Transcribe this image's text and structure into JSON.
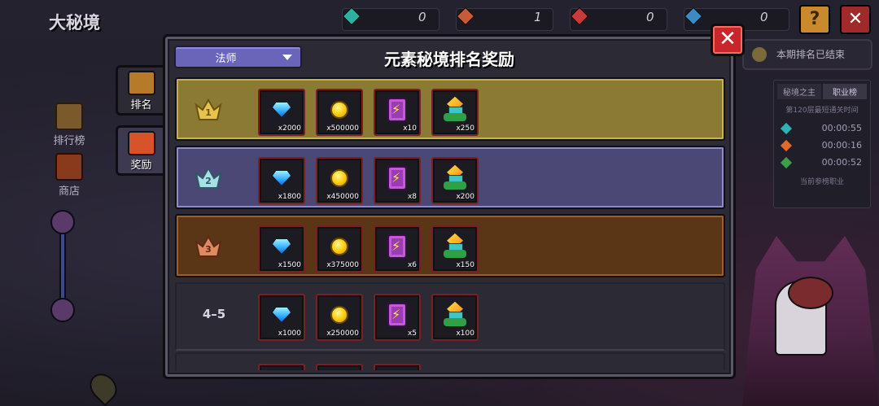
{
  "page_title": "大秘境",
  "resources": [
    {
      "name": "element-1",
      "value": "0",
      "color": "#2eb0a0"
    },
    {
      "name": "element-2",
      "value": "1",
      "color": "#c85a3a"
    },
    {
      "name": "element-3",
      "value": "0",
      "color": "#c83a3a"
    },
    {
      "name": "element-4",
      "value": "0",
      "color": "#3a8ac8"
    }
  ],
  "top_buttons": {
    "help": "?",
    "close": "✕"
  },
  "left_nav": [
    {
      "label": "排行榜",
      "icon": "trophy-icon"
    },
    {
      "label": "商店",
      "icon": "shop-icon"
    }
  ],
  "modal": {
    "title": "元素秘境排名奖励",
    "class_select": "法师",
    "close": "✕",
    "tabs": [
      {
        "label": "排名",
        "icon": "trophy-icon"
      },
      {
        "label": "奖励",
        "icon": "chest-icon"
      }
    ],
    "rows": [
      {
        "rank": "1",
        "style": "gold",
        "rewards": [
          {
            "icon": "diamond-icon",
            "count": "x2000"
          },
          {
            "icon": "coin-icon",
            "count": "x500000"
          },
          {
            "icon": "energy-icon",
            "count": "x10"
          },
          {
            "icon": "tree-icon",
            "count": "x250"
          }
        ]
      },
      {
        "rank": "2",
        "style": "silver",
        "rewards": [
          {
            "icon": "diamond-icon",
            "count": "x1800"
          },
          {
            "icon": "coin-icon",
            "count": "x450000"
          },
          {
            "icon": "energy-icon",
            "count": "x8"
          },
          {
            "icon": "tree-icon",
            "count": "x200"
          }
        ]
      },
      {
        "rank": "3",
        "style": "bronze",
        "rewards": [
          {
            "icon": "diamond-icon",
            "count": "x1500"
          },
          {
            "icon": "coin-icon",
            "count": "x375000"
          },
          {
            "icon": "energy-icon",
            "count": "x6"
          },
          {
            "icon": "tree-icon",
            "count": "x150"
          }
        ]
      },
      {
        "rank": "4–5",
        "style": "plain",
        "rewards": [
          {
            "icon": "diamond-icon",
            "count": "x1000"
          },
          {
            "icon": "coin-icon",
            "count": "x250000"
          },
          {
            "icon": "energy-icon",
            "count": "x5"
          },
          {
            "icon": "tree-icon",
            "count": "x100"
          }
        ]
      }
    ]
  },
  "right_panel": {
    "period_status": "本期排名已结束",
    "tabs": [
      "秘境之主",
      "职业榜"
    ],
    "subtitle": "第120层最短通关时间",
    "times": [
      {
        "element": "water",
        "color": "#2eb0b4",
        "time": "00:00:55"
      },
      {
        "element": "fire",
        "color": "#e06a2a",
        "time": "00:00:16"
      },
      {
        "element": "earth",
        "color": "#3aa04a",
        "time": "00:00:52"
      }
    ],
    "footer": "当前参榜职业"
  },
  "colors": {
    "gold": "#8a7a34",
    "silver": "#4b4876",
    "bronze": "#5a3516",
    "accent_red": "#c8262a"
  }
}
